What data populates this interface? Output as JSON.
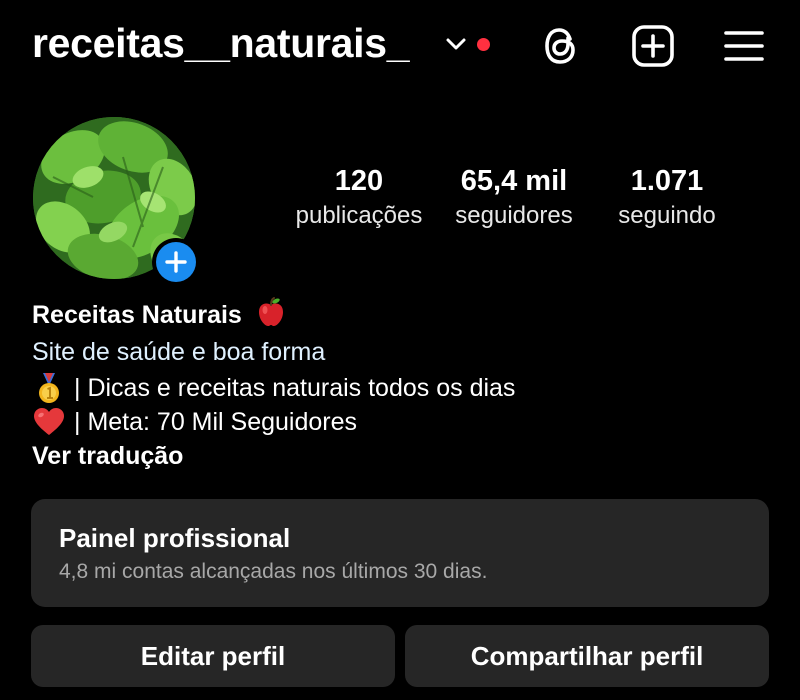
{
  "header": {
    "username": "receitas__naturais_",
    "icons": [
      "chevron-down-icon",
      "notification-dot",
      "threads-icon",
      "add-icon",
      "menu-icon"
    ],
    "notification_color": "#ff3040"
  },
  "profile": {
    "avatar": "leaf-photo",
    "add_story_icon": "plus-icon",
    "add_story_color": "#1a8cf0"
  },
  "stats": [
    {
      "value": "120",
      "label": "publicações"
    },
    {
      "value": "65,4 mil",
      "label": "seguidores"
    },
    {
      "value": "1.071",
      "label": "seguindo"
    }
  ],
  "bio": {
    "name": "Receitas Naturais",
    "name_emoji": "apple-icon",
    "category": "Site de saúde e boa forma",
    "lines": [
      {
        "emoji": "medal-icon",
        "text": "| Dicas e receitas naturais todos os dias"
      },
      {
        "emoji": "heart-icon",
        "text": "| Meta: 70 Mil Seguidores"
      }
    ],
    "translate": "Ver tradução"
  },
  "dashboard": {
    "title": "Painel profissional",
    "subtitle": "4,8 mi contas alcançadas nos últimos 30 dias."
  },
  "actions": {
    "edit": "Editar perfil",
    "share": "Compartilhar perfil"
  },
  "colors": {
    "background": "#000000",
    "surface": "#262626",
    "secondary_text": "#a8a8a8",
    "link_text": "#e0f1ff"
  }
}
